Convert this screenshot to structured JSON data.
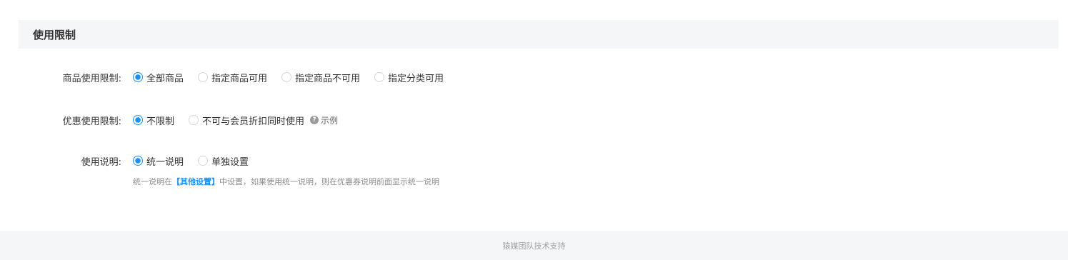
{
  "section": {
    "title": "使用限制"
  },
  "product_limit": {
    "label": "商品使用限制:",
    "options": [
      {
        "label": "全部商品",
        "checked": true
      },
      {
        "label": "指定商品可用",
        "checked": false
      },
      {
        "label": "指定商品不可用",
        "checked": false
      },
      {
        "label": "指定分类可用",
        "checked": false
      }
    ]
  },
  "discount_limit": {
    "label": "优惠使用限制:",
    "options": [
      {
        "label": "不限制",
        "checked": true
      },
      {
        "label": "不可与会员折扣同时使用",
        "checked": false
      }
    ],
    "example_label": "示例",
    "help_icon": "?"
  },
  "usage_note": {
    "label": "使用说明:",
    "options": [
      {
        "label": "统一说明",
        "checked": true
      },
      {
        "label": "单独设置",
        "checked": false
      }
    ],
    "hint_prefix": "统一说明在",
    "hint_link": "【其他设置】",
    "hint_suffix": "中设置，如果使用统一说明，则在优惠券说明前面显示统一说明"
  },
  "footer": {
    "text": "猿媒团队技术支持"
  },
  "colors": {
    "accent": "#1890ff",
    "header_bg": "#f5f6f8",
    "hint_text": "#8c8c8c"
  }
}
